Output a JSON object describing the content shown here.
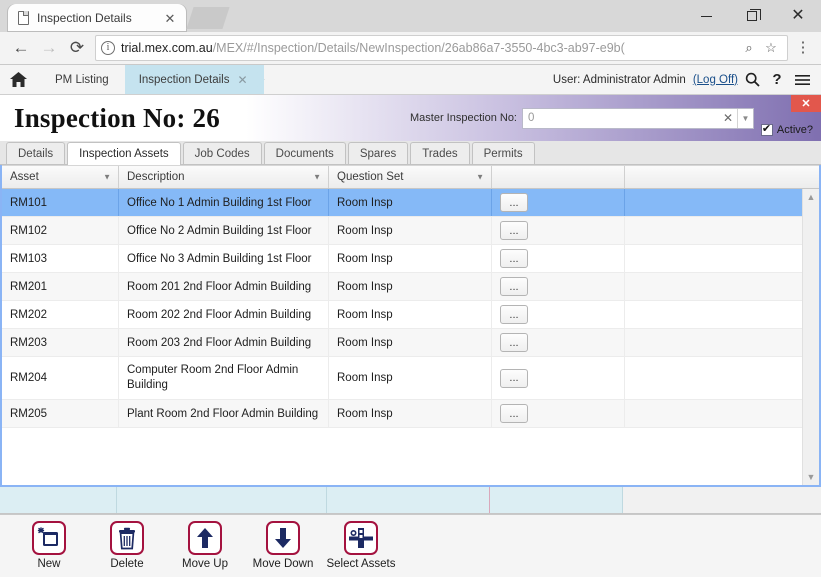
{
  "browser": {
    "tab": {
      "title": "Inspection Details",
      "favicon": "page-icon",
      "close": "✕"
    },
    "nav": {
      "back": "←",
      "forward": "→",
      "reload": "⟳"
    },
    "omnibox": {
      "info_icon": "ⓘ",
      "host": "trial.mex.com.au",
      "path": "/MEX/#/Inspection/Details/NewInspection/26ab86a7-3550-4bc3-ab97-e9b(",
      "search_icon": "⌕",
      "star_icon": "☆"
    },
    "menu": "⋮",
    "window": {
      "minimize": "—",
      "maximize": "❐",
      "close": "✕"
    }
  },
  "appnav": {
    "home": "home-icon",
    "crumbs": [
      {
        "label": "PM Listing",
        "active": false
      },
      {
        "label": "Inspection Details",
        "active": true,
        "close": "✕"
      }
    ],
    "user_text": "User: Administrator Admin",
    "logoff": "(Log Off)",
    "icons": {
      "search": "⌕",
      "help": "?",
      "menu": "☰"
    }
  },
  "header": {
    "title": "Inspection No:  26",
    "master_label": "Master Inspection No:",
    "master_value": "0",
    "master_clear": "✕",
    "master_caret": "▼",
    "active_label": "Active?",
    "active_checked": true,
    "close": "✕",
    "accent_color": "#7f6fb0",
    "close_color": "#e2574c"
  },
  "tabs": [
    {
      "label": "Details",
      "active": false
    },
    {
      "label": "Inspection Assets",
      "active": true
    },
    {
      "label": "Job Codes",
      "active": false
    },
    {
      "label": "Documents",
      "active": false
    },
    {
      "label": "Spares",
      "active": false
    },
    {
      "label": "Trades",
      "active": false
    },
    {
      "label": "Permits",
      "active": false
    }
  ],
  "grid": {
    "columns": [
      {
        "label": "Asset",
        "caret": "▼"
      },
      {
        "label": "Description",
        "caret": "▼"
      },
      {
        "label": "Question Set",
        "caret": "▼"
      }
    ],
    "ellipsis_label": "...",
    "selection_color": "#85b9f7",
    "rows": [
      {
        "asset": "RM101",
        "description": "Office No 1 Admin Building 1st Floor",
        "question_set": "Room Insp",
        "selected": true,
        "tall": false
      },
      {
        "asset": "RM102",
        "description": "Office No 2 Admin Building 1st Floor",
        "question_set": "Room Insp",
        "selected": false,
        "tall": false
      },
      {
        "asset": "RM103",
        "description": "Office No 3 Admin Building 1st Floor",
        "question_set": "Room Insp",
        "selected": false,
        "tall": false
      },
      {
        "asset": "RM201",
        "description": "Room 201 2nd Floor Admin Building",
        "question_set": "Room Insp",
        "selected": false,
        "tall": false
      },
      {
        "asset": "RM202",
        "description": "Room 202 2nd Floor Admin Building",
        "question_set": "Room Insp",
        "selected": false,
        "tall": false
      },
      {
        "asset": "RM203",
        "description": "Room 203 2nd Floor Admin Building",
        "question_set": "Room Insp",
        "selected": false,
        "tall": false
      },
      {
        "asset": "RM204",
        "description": "Computer Room 2nd Floor Admin Building",
        "question_set": "Room Insp",
        "selected": false,
        "tall": true
      },
      {
        "asset": "RM205",
        "description": "Plant Room 2nd Floor Admin Building",
        "question_set": "Room Insp",
        "selected": false,
        "tall": false
      }
    ],
    "scroll_up": "▲",
    "scroll_down": "▼"
  },
  "toolbar": {
    "buttons": [
      {
        "label": "New",
        "icon": "new-record-icon"
      },
      {
        "label": "Delete",
        "icon": "trash-icon"
      },
      {
        "label": "Move Up",
        "icon": "arrow-up-icon"
      },
      {
        "label": "Move Down",
        "icon": "arrow-down-icon"
      },
      {
        "label": "Select Assets",
        "icon": "select-assets-icon"
      }
    ],
    "accent_color": "#a4123f"
  }
}
